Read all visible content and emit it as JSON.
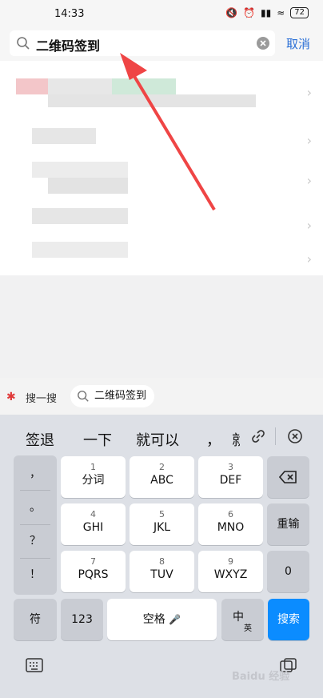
{
  "status": {
    "time": "14:33",
    "battery": "72"
  },
  "search": {
    "query": "二维码签到",
    "cancel": "取消"
  },
  "suggest": {
    "label": "搜一搜",
    "chip": "二维码签到"
  },
  "candidates": [
    "签退",
    "一下",
    "就可以",
    "，",
    "就"
  ],
  "keys": {
    "sym1": "，",
    "sym2": "。",
    "sym3": "？",
    "sym4": "！",
    "k1_num": "1",
    "k1": "分词",
    "k2_num": "2",
    "k2": "ABC",
    "k3_num": "3",
    "k3": "DEF",
    "k4_num": "4",
    "k4": "GHI",
    "k5_num": "5",
    "k5": "JKL",
    "k6_num": "6",
    "k6": "MNO",
    "k7_num": "7",
    "k7": "PQRS",
    "k8_num": "8",
    "k8": "TUV",
    "k9_num": "9",
    "k9": "WXYZ",
    "reenter": "重输",
    "zero": "0",
    "fu": "符",
    "n123": "123",
    "space": "空格",
    "zh": "中",
    "en": "英",
    "search": "搜索"
  },
  "watermark": "Baidu 经验"
}
